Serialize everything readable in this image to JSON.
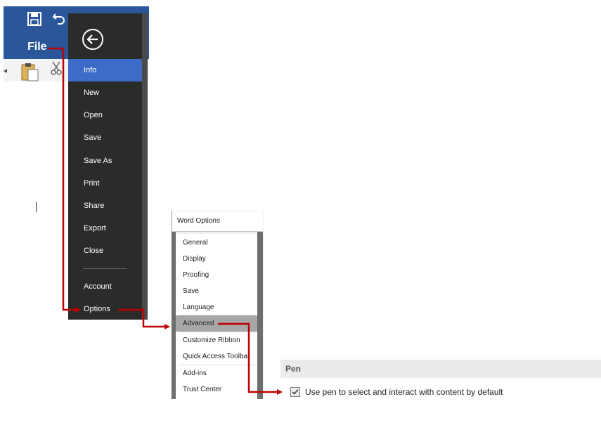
{
  "word_ribbon": {
    "file_tab_label": "File",
    "qat_icons": [
      "save-icon",
      "undo-icon"
    ],
    "ribbon_icons": [
      "paste-icon",
      "cut-icon"
    ],
    "colors": {
      "title_bar": "#2b579a",
      "ribbon": "#f3f3f3"
    }
  },
  "backstage": {
    "back_icon": "arrow-left-circle-icon",
    "items": [
      {
        "label": "Info",
        "active": true
      },
      {
        "label": "New"
      },
      {
        "label": "Open"
      },
      {
        "label": "Save"
      },
      {
        "label": "Save As"
      },
      {
        "label": "Print"
      },
      {
        "label": "Share"
      },
      {
        "label": "Export"
      },
      {
        "label": "Close"
      },
      {
        "label": "Account"
      },
      {
        "label": "Options"
      }
    ],
    "colors": {
      "background": "#2b2b2b",
      "active": "#3c6bc8",
      "text": "#ffffff"
    }
  },
  "word_options": {
    "title": "Word Options",
    "categories": [
      {
        "label": "General"
      },
      {
        "label": "Display"
      },
      {
        "label": "Proofing"
      },
      {
        "label": "Save"
      },
      {
        "label": "Language"
      },
      {
        "label": "Advanced",
        "active": true
      },
      {
        "label": "Customize Ribbon"
      },
      {
        "label": "Quick Access Toolbar"
      },
      {
        "label": "Add-ins"
      },
      {
        "label": "Trust Center"
      }
    ]
  },
  "pen_section": {
    "header": "Pen",
    "option_label": "Use pen to select and interact with content by default",
    "checked": true
  },
  "arrow_color": "#c00000"
}
